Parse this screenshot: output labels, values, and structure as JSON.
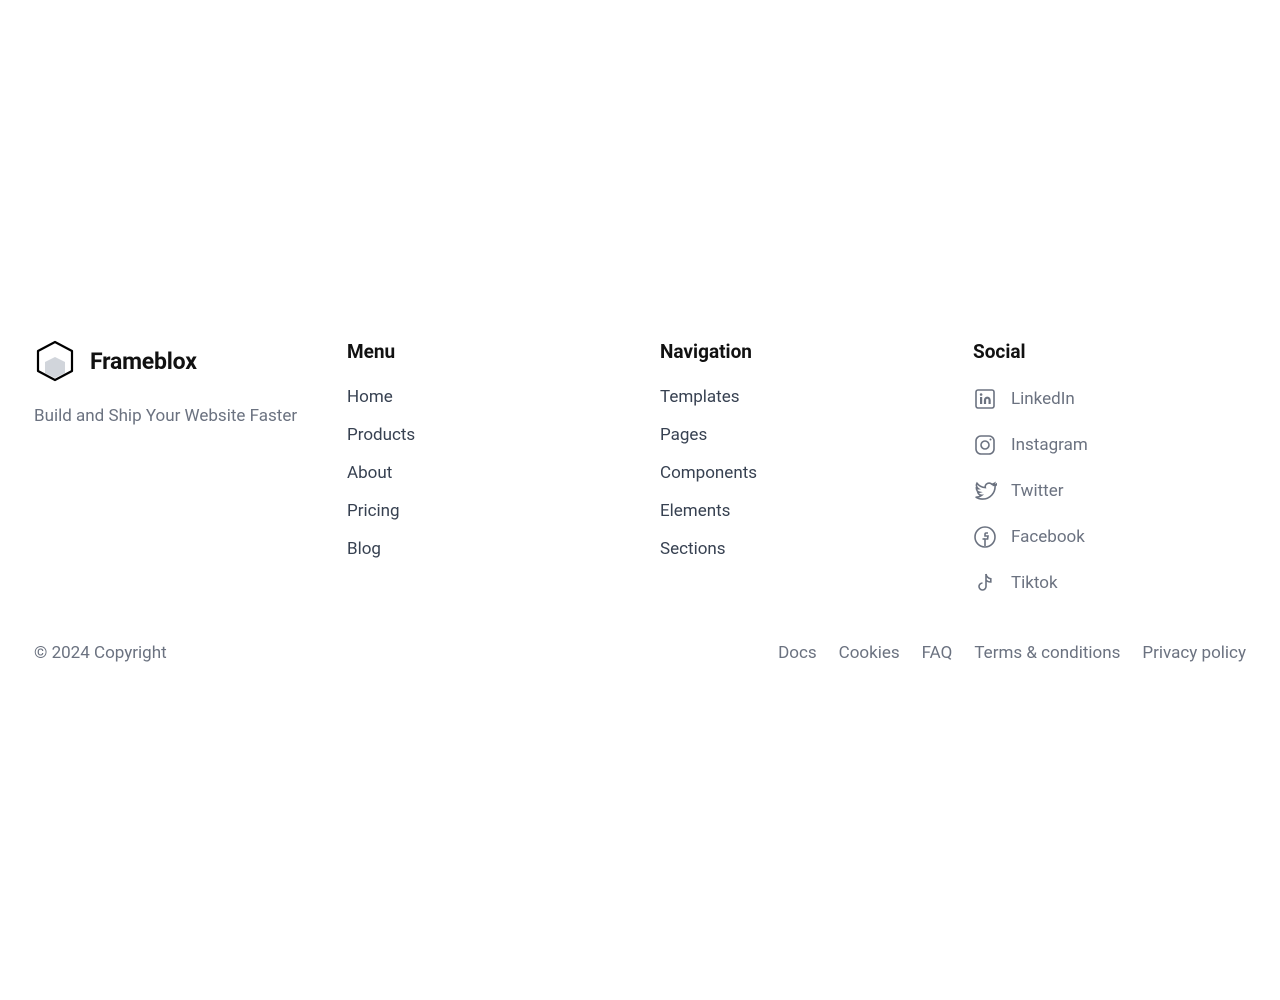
{
  "brand": {
    "name": "Frameblox",
    "tagline": "Build and Ship Your Website Faster"
  },
  "menu": {
    "heading": "Menu",
    "items": [
      "Home",
      "Products",
      "About",
      "Pricing",
      "Blog"
    ]
  },
  "navigation": {
    "heading": "Navigation",
    "items": [
      "Templates",
      "Pages",
      "Components",
      "Elements",
      "Sections"
    ]
  },
  "social": {
    "heading": "Social",
    "items": [
      {
        "label": "LinkedIn",
        "icon": "linkedin-icon"
      },
      {
        "label": "Instagram",
        "icon": "instagram-icon"
      },
      {
        "label": "Twitter",
        "icon": "twitter-icon"
      },
      {
        "label": "Facebook",
        "icon": "facebook-icon"
      },
      {
        "label": "Tiktok",
        "icon": "tiktok-icon"
      }
    ]
  },
  "bottom": {
    "copyright": "© 2024 Copyright",
    "links": [
      "Docs",
      "Cookies",
      "FAQ",
      "Terms & conditions",
      "Privacy policy"
    ]
  }
}
